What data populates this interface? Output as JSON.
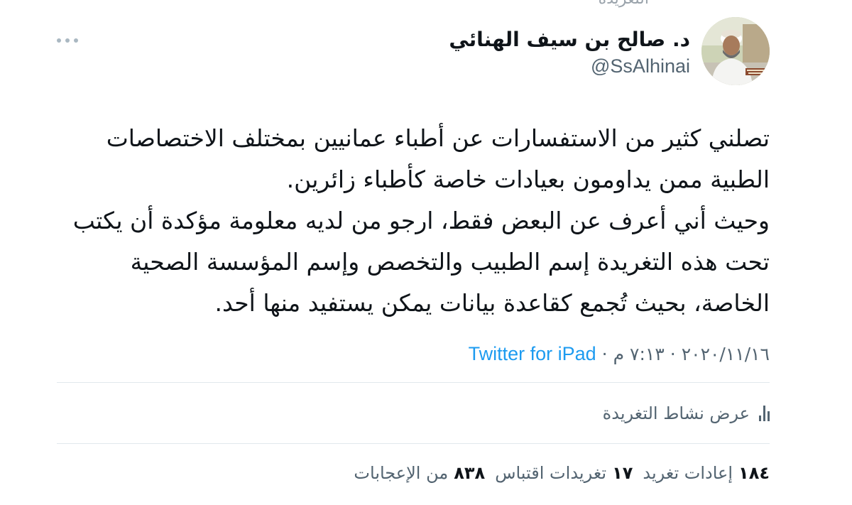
{
  "top_fragment": "التغريدة",
  "author": {
    "display_name": "د. صالح بن سيف الهنائي",
    "handle": "@SsAlhinai",
    "avatar_caption": "د. صالح بن سيف الهنائي"
  },
  "tweet": {
    "lines": [
      "تصلني كثير من الاستفسارات عن أطباء عمانيين بمختلف الاختصاصات",
      "الطبية ممن يداومون بعيادات خاصة كأطباء زائرين.",
      "وحيث أني أعرف عن البعض فقط، ارجو من لديه معلومة مؤكدة أن يكتب",
      "تحت هذه التغريدة إسم الطبيب والتخصص وإسم المؤسسة الصحية",
      "الخاصة، بحيث تُجمع كقاعدة بيانات يمكن يستفيد منها أحد."
    ]
  },
  "meta": {
    "date": "٢٠٢٠/١١/١٦",
    "time": "٧:١٣ م",
    "separator": "·",
    "source": "Twitter for iPad"
  },
  "activity": {
    "label": "عرض نشاط التغريدة",
    "icon": "analytics-icon"
  },
  "stats": {
    "retweets_count": "١٨٤",
    "retweets_label": "إعادات تغريد",
    "quotes_count": "١٧",
    "quotes_label": "تغريدات اقتباس",
    "likes_count": "٨٣٨",
    "likes_label": "من الإعجابات"
  },
  "colors": {
    "link": "#1d9bf0",
    "secondary_text": "#536471",
    "divider": "#e1e8ed"
  }
}
